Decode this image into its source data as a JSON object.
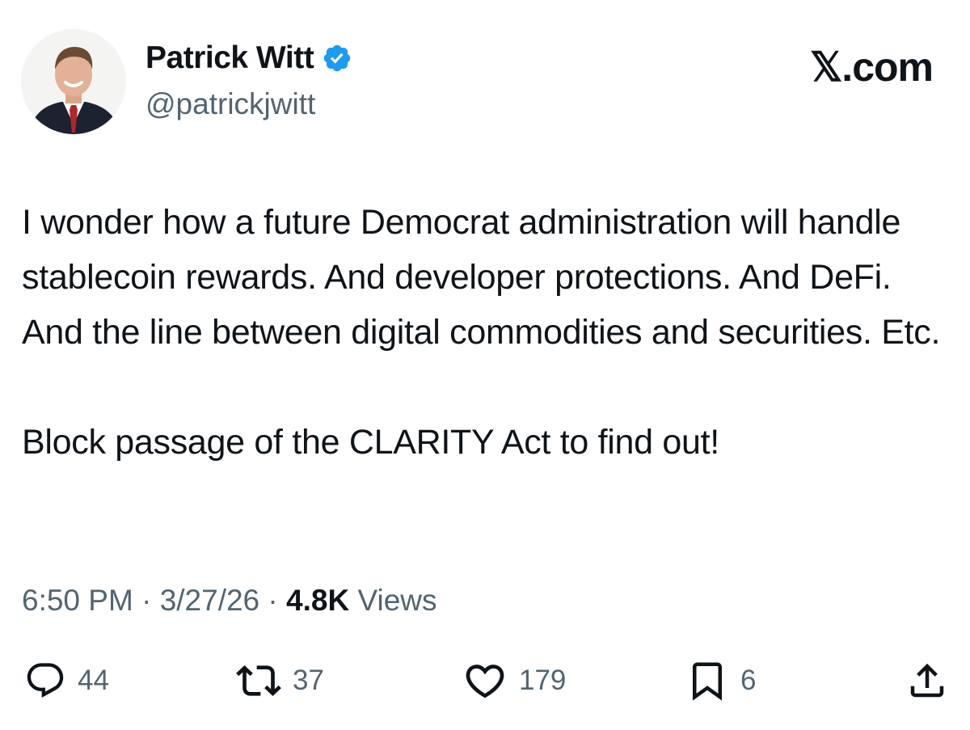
{
  "author": {
    "display_name": "Patrick Witt",
    "handle": "@patrickjwitt",
    "verified": true
  },
  "site_label": "𝕏.com",
  "tweet": {
    "paragraphs": [
      "I wonder how a future Democrat administration will handle stablecoin rewards. And developer protections. And DeFi. And the line between digital commodities and securities. Etc.",
      "Block passage of the CLARITY Act to find out!"
    ],
    "time": "6:50 PM",
    "date": "3/27/26",
    "views_count": "4.8K",
    "views_label": "Views",
    "separator": "·"
  },
  "actions": {
    "replies": "44",
    "reposts": "37",
    "likes": "179",
    "bookmarks": "6"
  },
  "icons": {
    "verified": "verified-badge-icon",
    "reply": "reply-icon",
    "repost": "repost-icon",
    "like": "heart-icon",
    "bookmark": "bookmark-icon",
    "share": "share-icon"
  },
  "colors": {
    "text_primary": "#0f1419",
    "text_secondary": "#536471",
    "verified_blue": "#1d9bf0"
  }
}
